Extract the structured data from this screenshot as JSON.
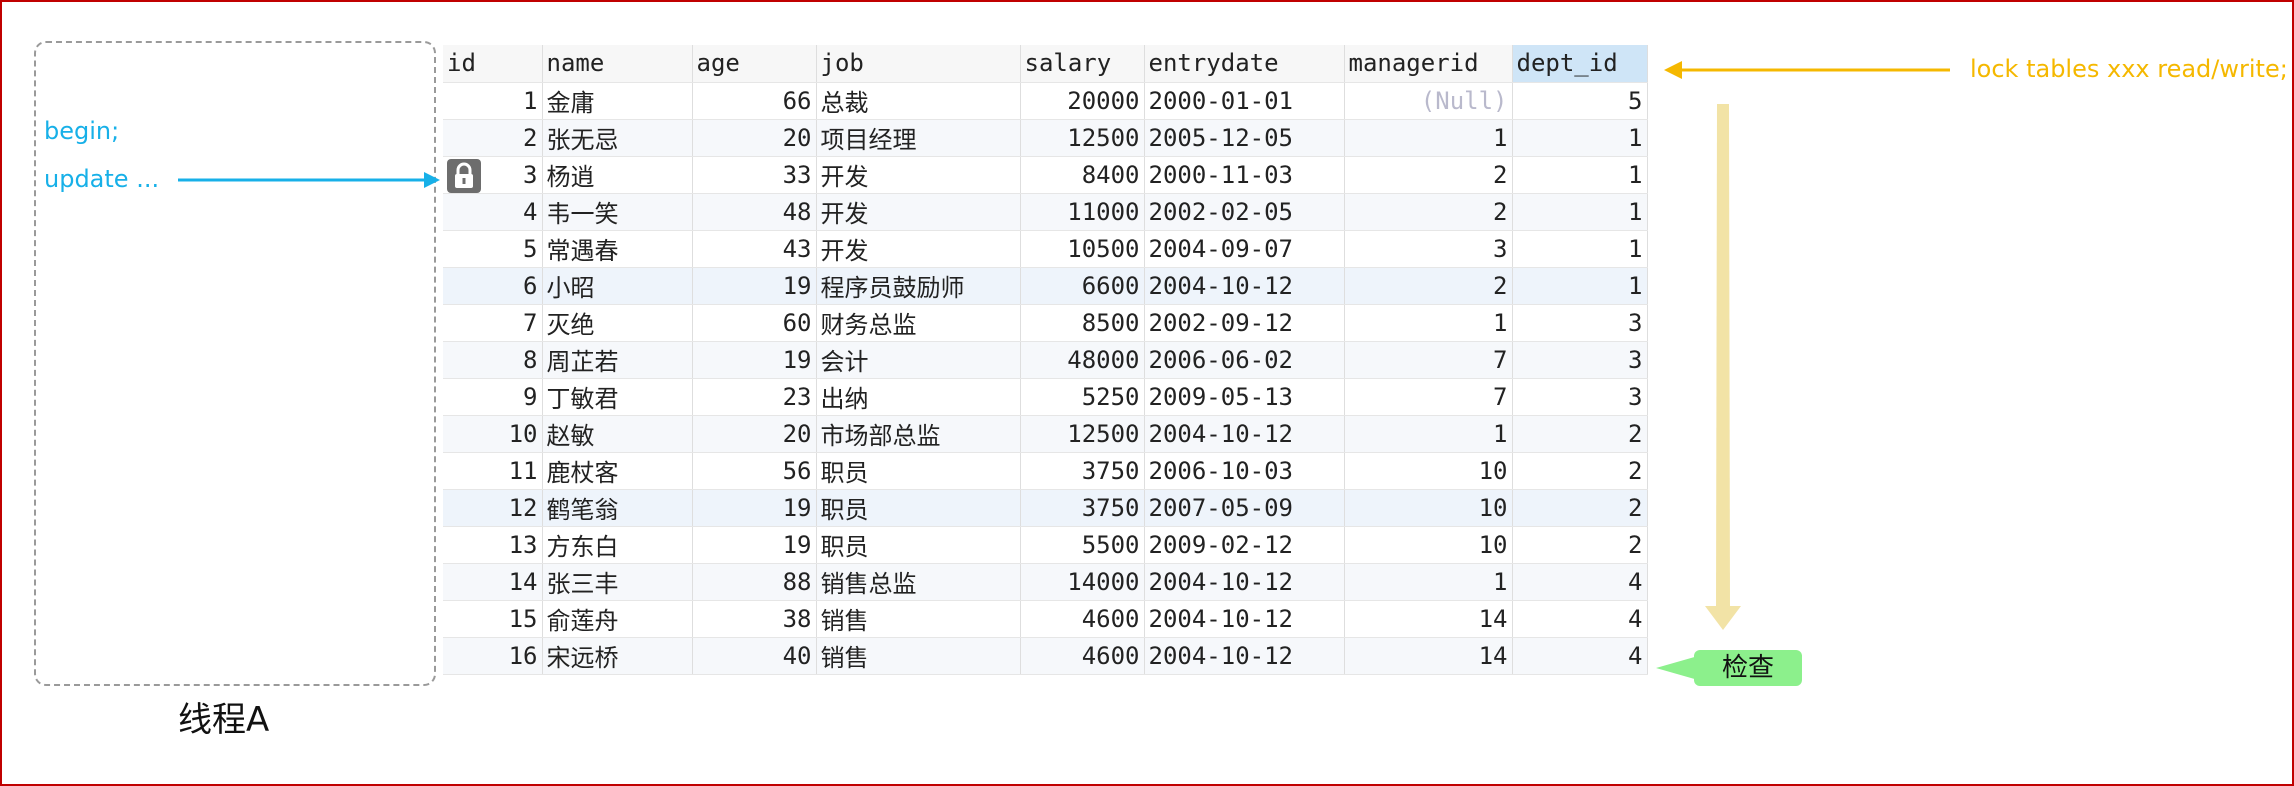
{
  "thread": {
    "label": "线程A",
    "begin": "begin;",
    "update": "update ..."
  },
  "lock_note": "lock tables xxx read/write;",
  "check_label": "检查",
  "table": {
    "columns": [
      "id",
      "name",
      "age",
      "job",
      "salary",
      "entrydate",
      "managerid",
      "dept_id"
    ],
    "highlight_column": "dept_id",
    "locked_row_id": "3",
    "rows": [
      [
        "1",
        "金庸",
        "66",
        "总裁",
        "20000",
        "2000-01-01",
        "(Null)",
        "5"
      ],
      [
        "2",
        "张无忌",
        "20",
        "项目经理",
        "12500",
        "2005-12-05",
        "1",
        "1"
      ],
      [
        "3",
        "杨逍",
        "33",
        "开发",
        "8400",
        "2000-11-03",
        "2",
        "1"
      ],
      [
        "4",
        "韦一笑",
        "48",
        "开发",
        "11000",
        "2002-02-05",
        "2",
        "1"
      ],
      [
        "5",
        "常遇春",
        "43",
        "开发",
        "10500",
        "2004-09-07",
        "3",
        "1"
      ],
      [
        "6",
        "小昭",
        "19",
        "程序员鼓励师",
        "6600",
        "2004-10-12",
        "2",
        "1"
      ],
      [
        "7",
        "灭绝",
        "60",
        "财务总监",
        "8500",
        "2002-09-12",
        "1",
        "3"
      ],
      [
        "8",
        "周芷若",
        "19",
        "会计",
        "48000",
        "2006-06-02",
        "7",
        "3"
      ],
      [
        "9",
        "丁敏君",
        "23",
        "出纳",
        "5250",
        "2009-05-13",
        "7",
        "3"
      ],
      [
        "10",
        "赵敏",
        "20",
        "市场部总监",
        "12500",
        "2004-10-12",
        "1",
        "2"
      ],
      [
        "11",
        "鹿杖客",
        "56",
        "职员",
        "3750",
        "2006-10-03",
        "10",
        "2"
      ],
      [
        "12",
        "鹤笔翁",
        "19",
        "职员",
        "3750",
        "2007-05-09",
        "10",
        "2"
      ],
      [
        "13",
        "方东白",
        "19",
        "职员",
        "5500",
        "2009-02-12",
        "10",
        "2"
      ],
      [
        "14",
        "张三丰",
        "88",
        "销售总监",
        "14000",
        "2004-10-12",
        "1",
        "4"
      ],
      [
        "15",
        "俞莲舟",
        "38",
        "销售",
        "4600",
        "2004-10-12",
        "14",
        "4"
      ],
      [
        "16",
        "宋远桥",
        "40",
        "销售",
        "4600",
        "2004-10-12",
        "14",
        "4"
      ]
    ]
  },
  "colors": {
    "frame": "#c00000",
    "thread_note": "#17b0e8",
    "lock_note": "#f5b800",
    "check_badge": "#8cf08c",
    "header_highlight": "#cfe5f7",
    "scan_arrow": "#f2e3a6"
  },
  "icons": {
    "row_lock": "lock-icon"
  }
}
